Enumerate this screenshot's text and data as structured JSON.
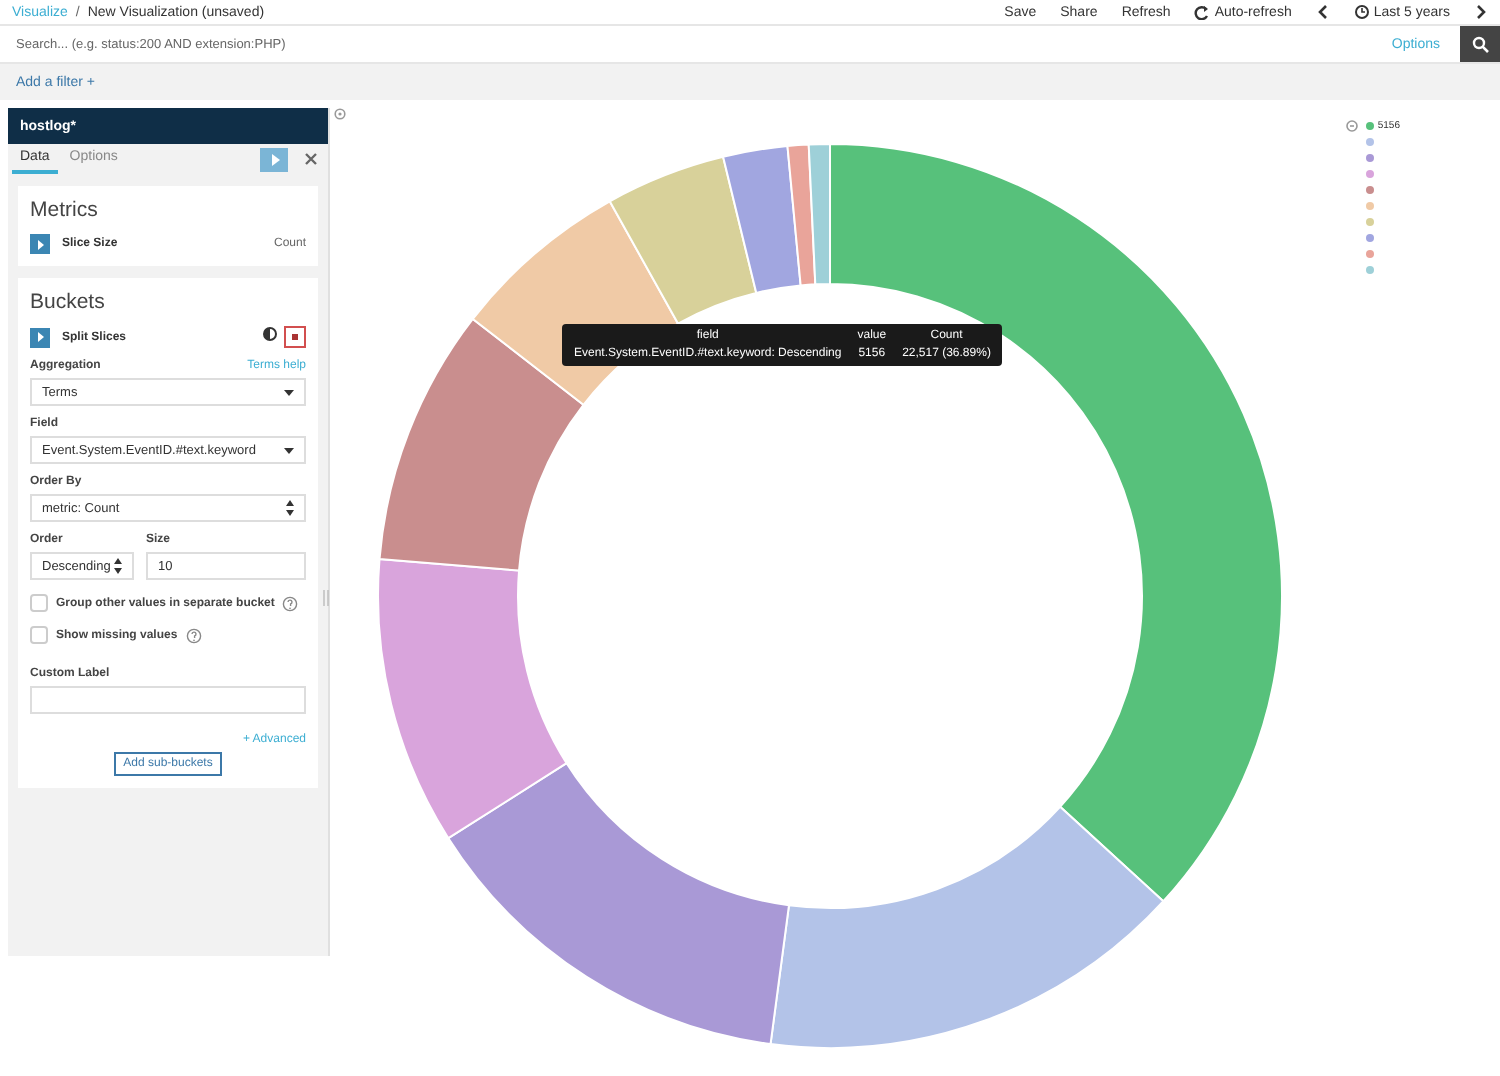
{
  "breadcrumb": {
    "parent": "Visualize",
    "separator": "/",
    "current": "New Visualization (unsaved)"
  },
  "top_menu": [
    "Save",
    "Share",
    "Refresh",
    "Auto-refresh"
  ],
  "time_range": "Last 5 years",
  "search": {
    "placeholder": "Search... (e.g. status:200 AND extension:PHP)",
    "options_link": "Options"
  },
  "add_filter": "Add a filter +",
  "sidebar": {
    "index_pattern": "hostlog*",
    "tabs": [
      {
        "label": "Data",
        "selected": true
      },
      {
        "label": "Options",
        "selected": false
      }
    ],
    "metrics": {
      "title": "Metrics",
      "items": [
        {
          "label": "Slice Size",
          "value": "Count"
        }
      ]
    },
    "buckets": {
      "title": "Buckets",
      "item": "Split Slices",
      "aggregation": {
        "label": "Aggregation",
        "help": "Terms help",
        "value": "Terms"
      },
      "field": {
        "label": "Field",
        "value": "Event.System.EventID.#text.keyword"
      },
      "order_by": {
        "label": "Order By",
        "value": "metric: Count"
      },
      "order": {
        "label": "Order",
        "value": "Descending"
      },
      "size": {
        "label": "Size",
        "value": "10"
      },
      "checkboxes": [
        {
          "label": "Group other values in separate bucket",
          "checked": false
        },
        {
          "label": "Show missing values",
          "checked": false
        }
      ],
      "custom_label": {
        "label": "Custom Label"
      },
      "advanced": "+ Advanced",
      "add_button": "Add sub-buckets"
    }
  },
  "tooltip": {
    "columns": [
      "field",
      "value",
      "Count"
    ],
    "row": [
      "Event.System.EventID.#text.keyword: Descending",
      "5156",
      "22,517 (36.89%)"
    ]
  },
  "legend": [
    {
      "label": "5156",
      "color": "#57c17b"
    },
    {
      "color": "#b3c3e8"
    },
    {
      "color": "#a999d6"
    },
    {
      "color": "#d9a4dc"
    },
    {
      "color": "#c98e8e"
    },
    {
      "color": "#f0caa6"
    },
    {
      "color": "#d8d19a"
    },
    {
      "color": "#a1a6e0"
    },
    {
      "color": "#e9a49a"
    },
    {
      "color": "#9ed0d8"
    }
  ]
}
